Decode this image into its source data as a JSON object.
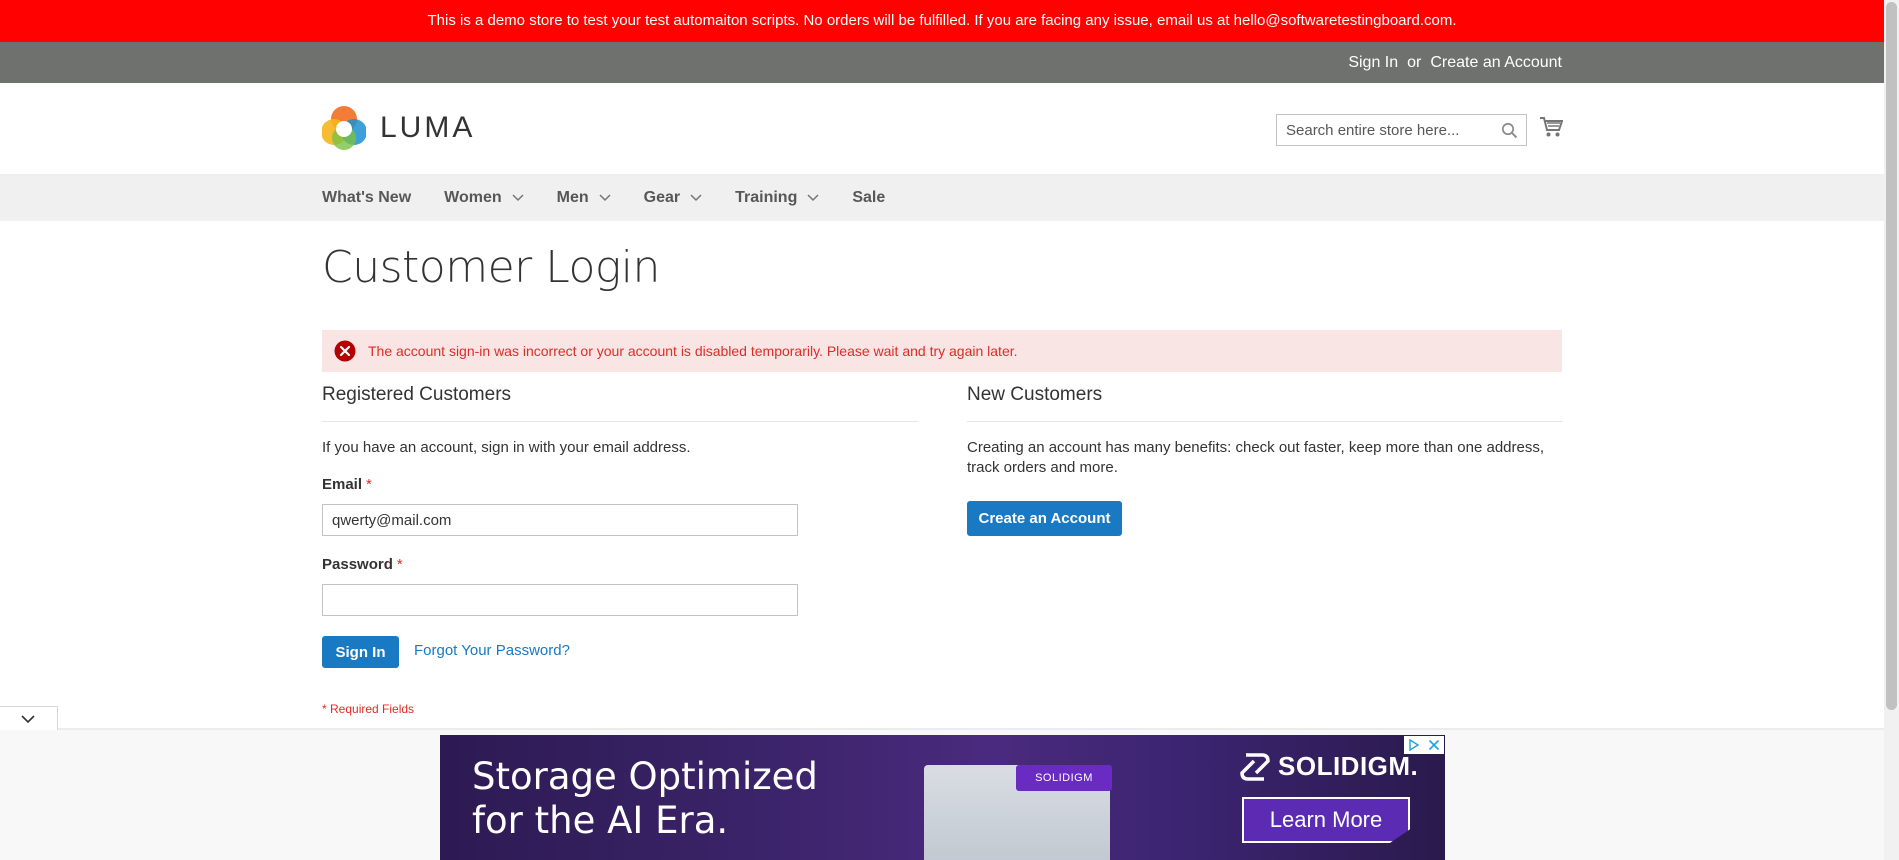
{
  "banner": {
    "text": "This is a demo store to test your test automaiton scripts. No orders will be fulfilled. If you are facing any issue, email us at hello@softwaretestingboard.com."
  },
  "header_links": {
    "sign_in": "Sign In",
    "or": "or",
    "create_account": "Create an Account"
  },
  "logo": {
    "text": "LUMA",
    "icon": "luma-logo-icon"
  },
  "search": {
    "placeholder": "Search entire store here...",
    "icon": "search-icon"
  },
  "cart": {
    "icon": "cart-icon"
  },
  "nav": {
    "items": [
      {
        "label": "What's New",
        "has_dropdown": false
      },
      {
        "label": "Women",
        "has_dropdown": true
      },
      {
        "label": "Men",
        "has_dropdown": true
      },
      {
        "label": "Gear",
        "has_dropdown": true
      },
      {
        "label": "Training",
        "has_dropdown": true
      },
      {
        "label": "Sale",
        "has_dropdown": false
      }
    ]
  },
  "page": {
    "title": "Customer Login"
  },
  "error": {
    "message": "The account sign-in was incorrect or your account is disabled temporarily. Please wait and try again later.",
    "icon": "error-icon"
  },
  "registered": {
    "title": "Registered Customers",
    "intro": "If you have an account, sign in with your email address.",
    "email_label": "Email",
    "email_value": "qwerty@mail.com",
    "password_label": "Password",
    "password_value": "",
    "required_marker": "*",
    "sign_in_button": "Sign In",
    "forgot_link": "Forgot Your Password?",
    "required_note": "* Required Fields"
  },
  "new_customers": {
    "title": "New Customers",
    "text": "Creating an account has many benefits: check out faster, keep more than one address, track orders and more.",
    "create_button": "Create an Account"
  },
  "ad": {
    "headline_line1": "Storage Optimized",
    "headline_line2": "for the AI Era.",
    "product_badge": "SOLIDIGM",
    "brand": "SOLIDIGM.",
    "cta": "Learn More"
  },
  "colors": {
    "banner_bg": "#ff0101",
    "header_links_bg": "#6e716e",
    "nav_bg": "#f0f0f0",
    "primary": "#1979c3",
    "error_bg": "#fae5e5",
    "error_text": "#e02b27"
  }
}
